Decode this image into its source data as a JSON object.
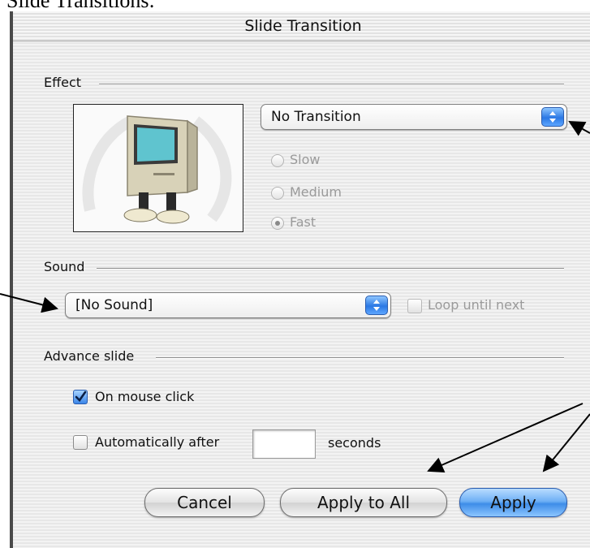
{
  "document": {
    "heading": "Slide Transitions:"
  },
  "window": {
    "title": "Slide Transition"
  },
  "effect": {
    "label": "Effect",
    "transition_popup": {
      "value": "No Transition"
    },
    "speed_options": [
      {
        "label": "Slow",
        "selected": false
      },
      {
        "label": "Medium",
        "selected": false
      },
      {
        "label": "Fast",
        "selected": true
      }
    ]
  },
  "sound": {
    "label": "Sound",
    "popup": {
      "value": "[No Sound]"
    },
    "loop_label": "Loop until next",
    "loop_checked": false
  },
  "advance": {
    "label": "Advance slide",
    "mouse_click_label": "On mouse click",
    "mouse_click_checked": true,
    "auto_label": "Automatically after",
    "auto_checked": false,
    "seconds_value": "",
    "seconds_label": "seconds"
  },
  "buttons": {
    "cancel": "Cancel",
    "apply_all": "Apply to All",
    "apply": "Apply"
  },
  "colors": {
    "accent_blue": "#3e8de8",
    "window_stripe": "#e7e7e7"
  },
  "icons": {
    "preview_image": "computer-mascot-icon"
  }
}
